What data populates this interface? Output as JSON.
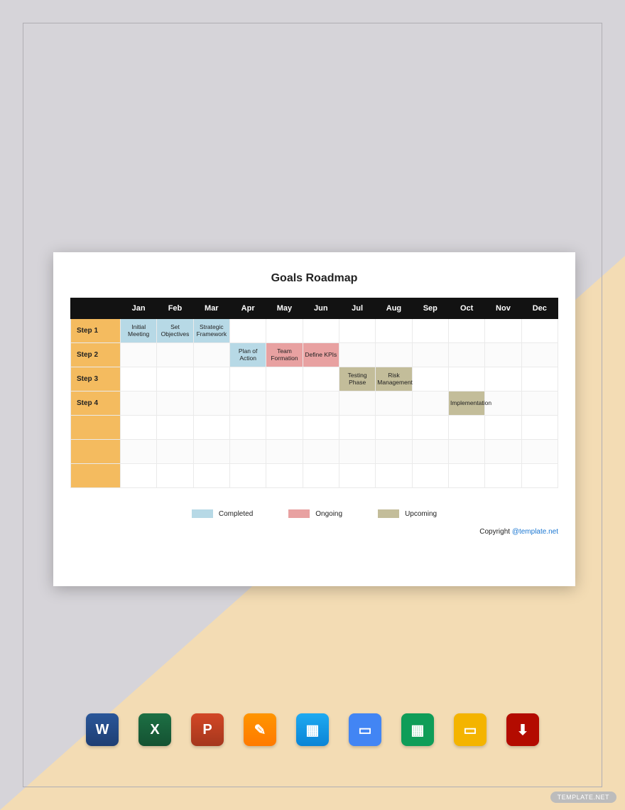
{
  "title": "Goals Roadmap",
  "months": [
    "Jan",
    "Feb",
    "Mar",
    "Apr",
    "May",
    "Jun",
    "Jul",
    "Aug",
    "Sep",
    "Oct",
    "Nov",
    "Dec"
  ],
  "rows": [
    {
      "label": "Step 1",
      "cells": [
        {
          "text": "Initial Meeting",
          "status": "completed"
        },
        {
          "text": "Set Objectives",
          "status": "completed"
        },
        {
          "text": "Strategic Framework",
          "status": "completed"
        },
        {},
        {},
        {},
        {},
        {},
        {},
        {},
        {},
        {}
      ]
    },
    {
      "label": "Step 2",
      "cells": [
        {},
        {},
        {},
        {
          "text": "Plan of Action",
          "status": "completed"
        },
        {
          "text": "Team Formation",
          "status": "ongoing"
        },
        {
          "text": "Define KPIs",
          "status": "ongoing"
        },
        {},
        {},
        {},
        {},
        {},
        {}
      ]
    },
    {
      "label": "Step 3",
      "cells": [
        {},
        {},
        {},
        {},
        {},
        {},
        {
          "text": "Testing Phase",
          "status": "upcoming"
        },
        {
          "text": "Risk Management",
          "status": "upcoming"
        },
        {},
        {},
        {},
        {}
      ]
    },
    {
      "label": "Step 4",
      "cells": [
        {},
        {},
        {},
        {},
        {},
        {},
        {},
        {},
        {},
        {
          "text": "Implementation",
          "status": "upcoming"
        },
        {},
        {}
      ]
    },
    {
      "label": "",
      "cells": [
        {},
        {},
        {},
        {},
        {},
        {},
        {},
        {},
        {},
        {},
        {},
        {}
      ]
    },
    {
      "label": "",
      "cells": [
        {},
        {},
        {},
        {},
        {},
        {},
        {},
        {},
        {},
        {},
        {},
        {}
      ]
    },
    {
      "label": "",
      "cells": [
        {},
        {},
        {},
        {},
        {},
        {},
        {},
        {},
        {},
        {},
        {},
        {}
      ]
    }
  ],
  "legend": {
    "completed": "Completed",
    "ongoing": "Ongoing",
    "upcoming": "Upcoming"
  },
  "copyright": {
    "prefix": "Copyright ",
    "link": "@template.net"
  },
  "apps": [
    {
      "name": "word-icon",
      "label": "W"
    },
    {
      "name": "excel-icon",
      "label": "X"
    },
    {
      "name": "powerpoint-icon",
      "label": "P"
    },
    {
      "name": "pages-icon",
      "label": "✎"
    },
    {
      "name": "keynote-icon",
      "label": "▦"
    },
    {
      "name": "gdocs-icon",
      "label": "▭"
    },
    {
      "name": "gsheets-icon",
      "label": "▦"
    },
    {
      "name": "gslides-icon",
      "label": "▭"
    },
    {
      "name": "pdf-icon",
      "label": "⬇"
    }
  ],
  "watermark": "TEMPLATE.NET",
  "chart_data": {
    "type": "table",
    "title": "Goals Roadmap",
    "columns": [
      "Jan",
      "Feb",
      "Mar",
      "Apr",
      "May",
      "Jun",
      "Jul",
      "Aug",
      "Sep",
      "Oct",
      "Nov",
      "Dec"
    ],
    "rows": [
      "Step 1",
      "Step 2",
      "Step 3",
      "Step 4"
    ],
    "tasks": [
      {
        "row": "Step 1",
        "month": "Jan",
        "label": "Initial Meeting",
        "status": "Completed"
      },
      {
        "row": "Step 1",
        "month": "Feb",
        "label": "Set Objectives",
        "status": "Completed"
      },
      {
        "row": "Step 1",
        "month": "Mar",
        "label": "Strategic Framework",
        "status": "Completed"
      },
      {
        "row": "Step 2",
        "month": "Apr",
        "label": "Plan of Action",
        "status": "Completed"
      },
      {
        "row": "Step 2",
        "month": "May",
        "label": "Team Formation",
        "status": "Ongoing"
      },
      {
        "row": "Step 2",
        "month": "Jun",
        "label": "Define KPIs",
        "status": "Ongoing"
      },
      {
        "row": "Step 3",
        "month": "Jul",
        "label": "Testing Phase",
        "status": "Upcoming"
      },
      {
        "row": "Step 3",
        "month": "Aug",
        "label": "Risk Management",
        "status": "Upcoming"
      },
      {
        "row": "Step 4",
        "month": "Oct",
        "label": "Implementation",
        "status": "Upcoming"
      }
    ],
    "legend": {
      "Completed": "#b7d9e6",
      "Ongoing": "#e8a1a1",
      "Upcoming": "#c3bd9a"
    }
  }
}
